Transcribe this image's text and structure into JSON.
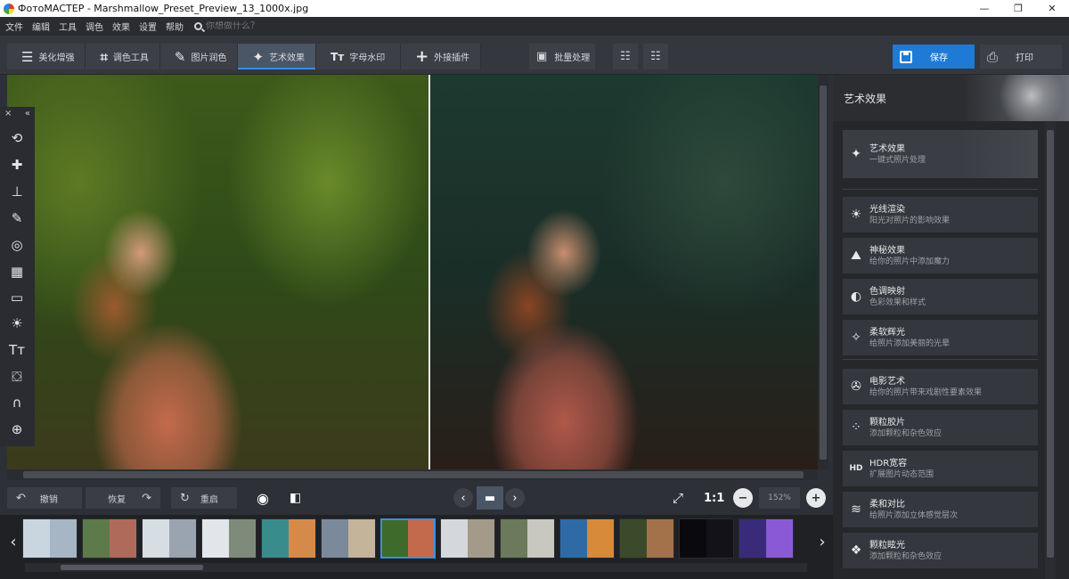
{
  "window": {
    "title": "ФотоМАСТЕР - Marshmallow_Preset_Preview_13_1000x.jpg",
    "minimize": "—",
    "maximize": "❐",
    "close": "✕"
  },
  "menu": {
    "items": [
      "文件",
      "编辑",
      "工具",
      "调色",
      "效果",
      "设置",
      "帮助"
    ],
    "search_placeholder": "你想做什么？"
  },
  "toolbar": {
    "tabs": [
      {
        "label": "美化增强",
        "icon": "sliders-icon",
        "glyph": "☰"
      },
      {
        "label": "调色工具",
        "icon": "crop-icon",
        "glyph": "⌗"
      },
      {
        "label": "图片润色",
        "icon": "brush-icon",
        "glyph": "✎"
      },
      {
        "label": "艺术效果",
        "icon": "magic-wand-icon",
        "glyph": "✦",
        "active": true
      },
      {
        "label": "字母水印",
        "icon": "text-icon",
        "glyph": "Tт"
      },
      {
        "label": "外接插件",
        "icon": "plus-icon",
        "glyph": "+"
      }
    ],
    "batch_label": "批量处理",
    "save_label": "保存",
    "print_label": "打印"
  },
  "bottom": {
    "undo_label": "撤销",
    "redo_label": "恢复",
    "reset_label": "重启",
    "ratio_label": "1:1",
    "zoom_value": "152%"
  },
  "filmstrip": {
    "thumbnails": [
      {
        "colors": [
          "#c9d6e0",
          "#a6b6c4"
        ]
      },
      {
        "colors": [
          "#5c7a4a",
          "#b06a5a"
        ]
      },
      {
        "colors": [
          "#d6dde3",
          "#9aa4b0"
        ]
      },
      {
        "colors": [
          "#e2e6ea",
          "#7f8b7a"
        ]
      },
      {
        "colors": [
          "#3a8c8c",
          "#d68a4a"
        ]
      },
      {
        "colors": [
          "#7a8a9a",
          "#c4b49a"
        ]
      },
      {
        "colors": [
          "#3e6a2c",
          "#c46a4c"
        ],
        "selected": true
      },
      {
        "colors": [
          "#d4d8dc",
          "#a49a8a"
        ]
      },
      {
        "colors": [
          "#6a7a5a",
          "#c8c8c0"
        ]
      },
      {
        "colors": [
          "#2e6aa6",
          "#d68a3a"
        ]
      },
      {
        "colors": [
          "#3a4a2a",
          "#a4724a"
        ]
      },
      {
        "colors": [
          "#0a0a0e",
          "#121218"
        ]
      },
      {
        "colors": [
          "#3a2a7a",
          "#8a5ad6"
        ]
      }
    ]
  },
  "panel": {
    "title": "艺术效果",
    "top_item": {
      "name": "艺术效果",
      "desc": "一键式照片处理",
      "icon": "magic-wand-icon",
      "glyph": "✦"
    },
    "items": [
      {
        "name": "光线渲染",
        "desc": "阳光对照片的影响效果",
        "icon": "sun-icon",
        "glyph": "☀"
      },
      {
        "name": "神秘效果",
        "desc": "给你的照片中添加魔力",
        "icon": "landscape-icon",
        "glyph": "⛰"
      },
      {
        "name": "色调映射",
        "desc": "色彩效果和样式",
        "icon": "contrast-circle-icon",
        "glyph": "◐"
      },
      {
        "name": "柔软辉光",
        "desc": "给照片添加美丽的光晕",
        "icon": "sparkle-icon",
        "glyph": "✧"
      },
      {
        "name": "电影艺术",
        "desc": "给你的照片带来戏剧性要素效果",
        "icon": "film-reel-icon",
        "glyph": "✇"
      },
      {
        "name": "颗粒胶片",
        "desc": "添加颗粒和杂色效应",
        "icon": "grain-icon",
        "glyph": "⁘"
      },
      {
        "name": "HDR宽容",
        "desc": "扩展图片动态范围",
        "icon": "hdr-icon",
        "glyph": "HD"
      },
      {
        "name": "柔和对比",
        "desc": "给照片添加立体感觉层次",
        "icon": "layers-icon",
        "glyph": "≋"
      },
      {
        "name": "颗粒眩光",
        "desc": "添加颗粒和杂色效应",
        "icon": "glare-icon",
        "glyph": "❖"
      }
    ]
  }
}
